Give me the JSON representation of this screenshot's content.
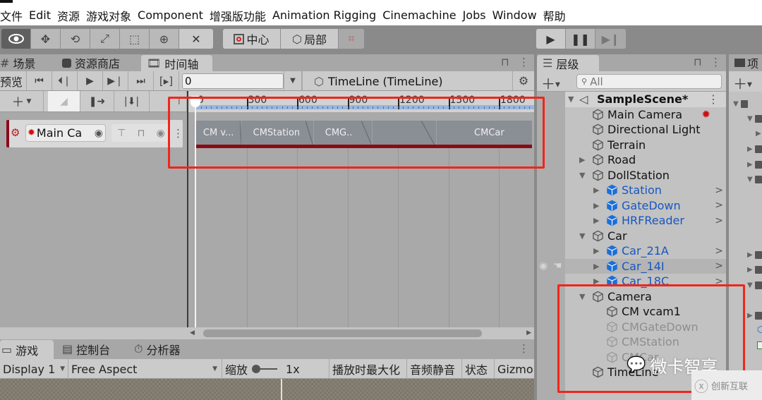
{
  "menubar": {
    "items": [
      "文件",
      "Edit",
      "资源",
      "游戏对象",
      "Component",
      "增强版功能",
      "Animation Rigging",
      "Cinemachine",
      "Jobs",
      "Window",
      "帮助"
    ]
  },
  "toolbar": {
    "tools": [
      "view-eye",
      "move",
      "rotate",
      "scale",
      "rect",
      "transform",
      "custom-tools"
    ],
    "pivot_label": "中心",
    "space_label": "局部",
    "snap_icon": "snap-grid",
    "play_controls": [
      "play",
      "pause",
      "step"
    ]
  },
  "timeline_window": {
    "tabs": [
      {
        "label": "场景",
        "icon": "grid-icon"
      },
      {
        "label": "资源商店",
        "icon": "bag-icon"
      },
      {
        "label": "时间轴",
        "icon": "film-icon",
        "active": true
      }
    ],
    "preview_label": "预览",
    "frame_field": "0",
    "asset_name": "TimeLine (TimeLine)",
    "ruler": {
      "labels": [
        "0",
        "300",
        "600",
        "900",
        "1200",
        "1500",
        "1800"
      ]
    },
    "track": {
      "name": "Main Ca",
      "full_name": "Main Camera",
      "type": "Cinemachine Track"
    },
    "clips": [
      {
        "label": "CM v...",
        "start": 0,
        "end": 270
      },
      {
        "label": "CMStation",
        "start": 260,
        "end": 700
      },
      {
        "label": "CMG..",
        "start": 650,
        "end": 1050
      },
      {
        "label": "",
        "start": 980,
        "end": 1430
      },
      {
        "label": "CMCar",
        "start": 1340,
        "end": 2150
      }
    ],
    "playhead_frame": 0
  },
  "game_window": {
    "tabs": [
      {
        "label": "游戏",
        "icon": "gamepad-icon",
        "active": true
      },
      {
        "label": "控制台",
        "icon": "console-icon"
      },
      {
        "label": "分析器",
        "icon": "profiler-icon"
      }
    ],
    "display": "Display 1",
    "aspect": "Free Aspect",
    "scale_label": "缩放",
    "scale_value": "1x",
    "maximize_label": "播放时最大化",
    "mute_label": "音频静音",
    "stats_label": "状态",
    "gizmos_label": "Gizmo"
  },
  "hierarchy": {
    "tab_label": "层级",
    "search_placeholder": "All",
    "scene": "SampleScene*",
    "items": [
      {
        "label": "Main Camera",
        "depth": 1,
        "expand": "none",
        "style": "normal",
        "badge": "cinemachine-brain"
      },
      {
        "label": "Directional Light",
        "depth": 1,
        "expand": "none",
        "style": "normal"
      },
      {
        "label": "Terrain",
        "depth": 1,
        "expand": "none",
        "style": "normal"
      },
      {
        "label": "Road",
        "depth": 1,
        "expand": "collapsed",
        "style": "normal"
      },
      {
        "label": "DollStation",
        "depth": 1,
        "expand": "expanded",
        "style": "normal"
      },
      {
        "label": "Station",
        "depth": 2,
        "expand": "collapsed",
        "style": "prefab"
      },
      {
        "label": "GateDown",
        "depth": 2,
        "expand": "collapsed",
        "style": "prefab"
      },
      {
        "label": "HRFReader",
        "depth": 2,
        "expand": "collapsed",
        "style": "prefab"
      },
      {
        "label": "Car",
        "depth": 1,
        "expand": "expanded",
        "style": "normal"
      },
      {
        "label": "Car_21A",
        "depth": 2,
        "expand": "collapsed",
        "style": "prefab"
      },
      {
        "label": "Car_14I",
        "depth": 2,
        "expand": "collapsed",
        "style": "prefab",
        "hovered": true
      },
      {
        "label": "Car_18C",
        "depth": 2,
        "expand": "collapsed",
        "style": "prefab"
      },
      {
        "label": "Camera",
        "depth": 1,
        "expand": "expanded",
        "style": "normal"
      },
      {
        "label": "CM vcam1",
        "depth": 2,
        "expand": "none",
        "style": "normal"
      },
      {
        "label": "CMGateDown",
        "depth": 2,
        "expand": "none",
        "style": "disabled"
      },
      {
        "label": "CMStation",
        "depth": 2,
        "expand": "none",
        "style": "disabled"
      },
      {
        "label": "CMCar",
        "depth": 2,
        "expand": "none",
        "style": "disabled"
      },
      {
        "label": "TimeLine",
        "depth": 1,
        "expand": "none",
        "style": "normal"
      }
    ]
  },
  "project": {
    "tab_label": "项"
  },
  "watermark": {
    "text": "微卡智享",
    "brand": "创新互联"
  },
  "colors": {
    "highlight_box": "#f0261a",
    "prefab_blue": "#1757c0",
    "clip_accent": "#8c0a14",
    "ruler_blue": "#99b5e0"
  }
}
